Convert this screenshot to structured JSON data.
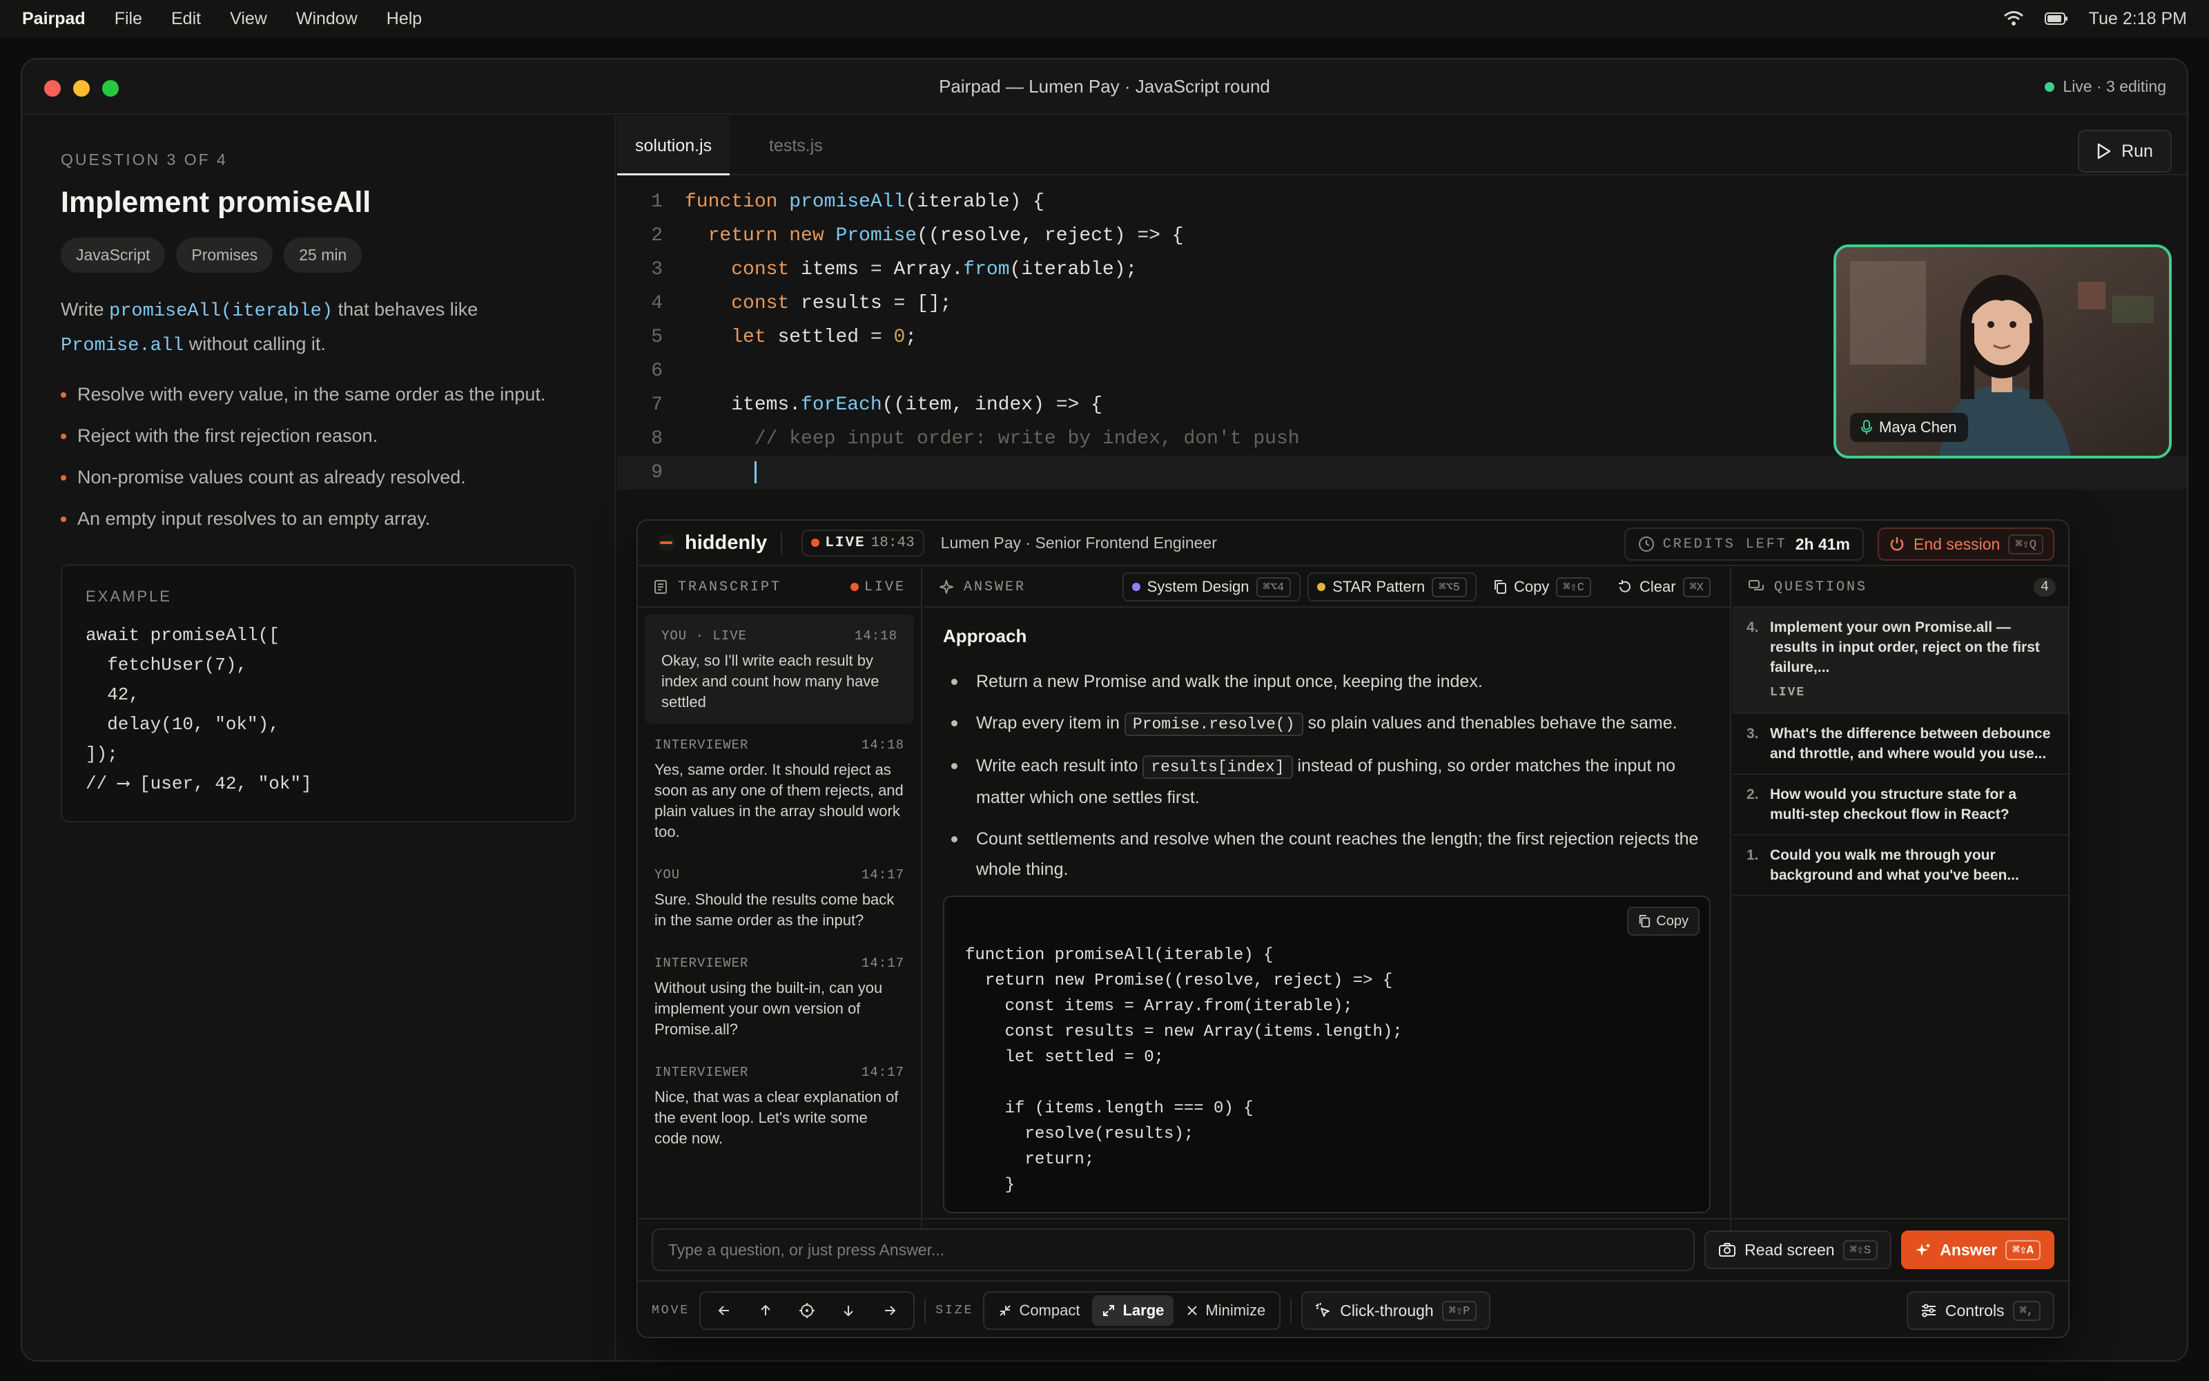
{
  "menubar": {
    "app": "Pairpad",
    "items": [
      "File",
      "Edit",
      "View",
      "Window",
      "Help"
    ],
    "clock": "Tue 2:18 PM"
  },
  "window": {
    "title": "Pairpad — Lumen Pay · JavaScript round",
    "status": "Live · 3 editing"
  },
  "question": {
    "counter": "QUESTION 3 OF 4",
    "title": "Implement promiseAll",
    "tags": [
      "JavaScript",
      "Promises",
      "25 min"
    ],
    "desc_pre": "Write ",
    "desc_code1": "promiseAll(iterable)",
    "desc_mid": " that behaves like",
    "desc_code2": "Promise.all",
    "desc_post": " without calling it.",
    "bullets": [
      "Resolve with every value, in the same order as the input.",
      "Reject with the first rejection reason.",
      "Non-promise values count as already resolved.",
      "An empty input resolves to an empty array."
    ],
    "example_label": "EXAMPLE",
    "example_code": "await promiseAll([\n  fetchUser(7),\n  42,\n  delay(10, \"ok\"),\n]);\n// ⟶ [user, 42, \"ok\"]"
  },
  "editor": {
    "tabs": [
      "solution.js",
      "tests.js"
    ],
    "run_label": "Run",
    "line_numbers": [
      "1",
      "2",
      "3",
      "4",
      "5",
      "6",
      "7",
      "8",
      "9"
    ],
    "video_name": "Maya Chen"
  },
  "overlay": {
    "brand": "hiddenly",
    "live": "LIVE",
    "live_time": "18:43",
    "company": "Lumen Pay · Senior Frontend Engineer",
    "credits_label": "CREDITS LEFT",
    "credits_value": "2h 41m",
    "end_session": "End session",
    "end_kbd": "⌘⇧Q",
    "transcript": {
      "title": "TRANSCRIPT",
      "live": "LIVE",
      "items": [
        {
          "who": "YOU · LIVE",
          "time": "14:18",
          "text": "Okay, so I'll write each result by index and count how many have settled"
        },
        {
          "who": "INTERVIEWER",
          "time": "14:18",
          "text": "Yes, same order. It should reject as soon as any one of them rejects, and plain values in the array should work too."
        },
        {
          "who": "YOU",
          "time": "14:17",
          "text": "Sure. Should the results come back in the same order as the input?"
        },
        {
          "who": "INTERVIEWER",
          "time": "14:17",
          "text": "Without using the built-in, can you implement your own version of Promise.all?"
        },
        {
          "who": "INTERVIEWER",
          "time": "14:17",
          "text": "Nice, that was a clear explanation of the event loop. Let's write some code now."
        }
      ]
    },
    "answer": {
      "title": "ANSWER",
      "chip1": "System Design",
      "chip1_kbd": "⌘⌥4",
      "chip2": "STAR Pattern",
      "chip2_kbd": "⌘⌥5",
      "copy": "Copy",
      "copy_kbd": "⌘⇧C",
      "clear": "Clear",
      "clear_kbd": "⌘X",
      "heading": "Approach",
      "b1": "Return a new Promise and walk the input once, keeping the index.",
      "b2_pre": "Wrap every item in ",
      "b2_code": "Promise.resolve()",
      "b2_post": " so plain values and thenables behave the same.",
      "b3_pre": "Write each result into ",
      "b3_code": "results[index]",
      "b3_post": " instead of pushing, so order matches the input no matter which one settles first.",
      "b4": "Count settlements and resolve when the count reaches the length; the first rejection rejects the whole thing.",
      "code_copy": "Copy",
      "code": "function promiseAll(iterable) {\n  return new Promise((resolve, reject) => {\n    const items = Array.from(iterable);\n    const results = new Array(items.length);\n    let settled = 0;\n\n    if (items.length === 0) {\n      resolve(results);\n      return;\n    }"
    },
    "questions": {
      "title": "QUESTIONS",
      "count": "4",
      "items": [
        {
          "n": "4.",
          "text": "Implement your own Promise.all — results in input order, reject on the first failure,...",
          "tag": "LIVE"
        },
        {
          "n": "3.",
          "text": "What's the difference between debounce and throttle, and where would you use..."
        },
        {
          "n": "2.",
          "text": "How would you structure state for a multi-step checkout flow in React?"
        },
        {
          "n": "1.",
          "text": "Could you walk me through your background and what you've been..."
        }
      ]
    },
    "input_placeholder": "Type a question, or just press Answer...",
    "read_screen": "Read screen",
    "read_kbd": "⌘⇧S",
    "answer_btn": "Answer",
    "answer_kbd": "⌘⇧A",
    "move_label": "MOVE",
    "size_label": "SIZE",
    "compact": "Compact",
    "large": "Large",
    "minimize": "Minimize",
    "click_through": "Click-through",
    "click_kbd": "⌘⇧P",
    "controls": "Controls",
    "controls_kbd": "⌘,"
  }
}
